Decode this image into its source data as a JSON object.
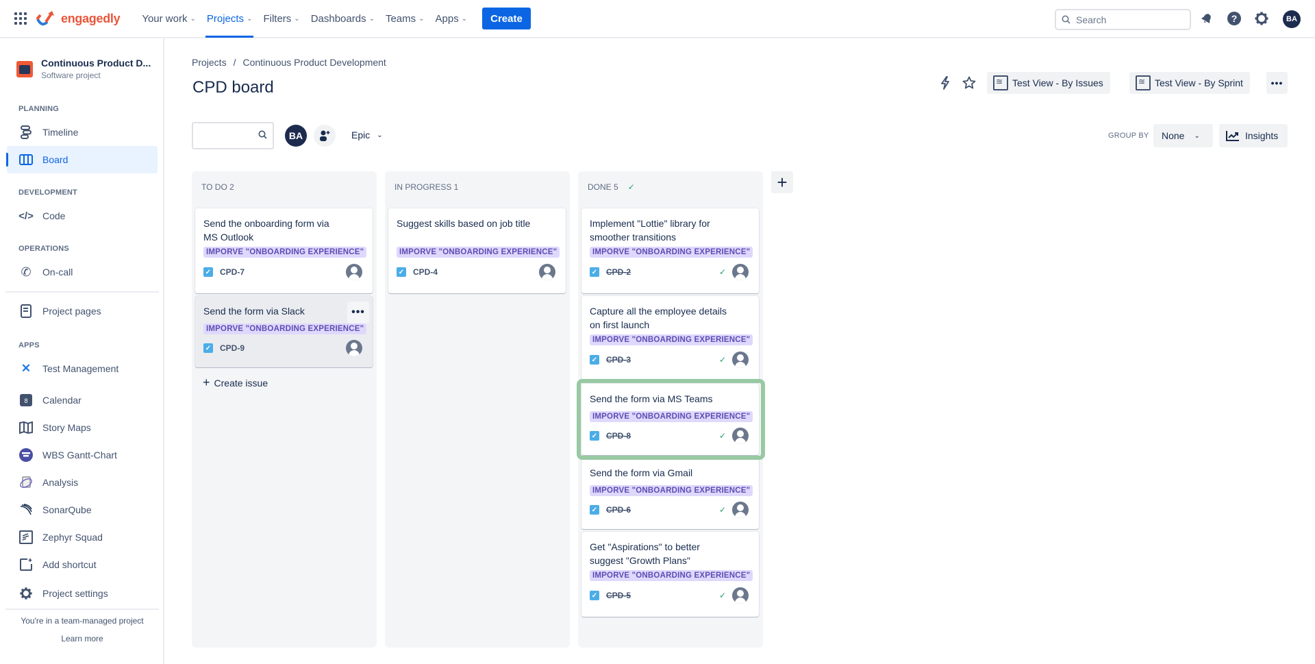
{
  "topnav": {
    "logo_text": "engagedly",
    "items": [
      {
        "label": "Your work",
        "active": false
      },
      {
        "label": "Projects",
        "active": true
      },
      {
        "label": "Filters",
        "active": false
      },
      {
        "label": "Dashboards",
        "active": false
      },
      {
        "label": "Teams",
        "active": false
      },
      {
        "label": "Apps",
        "active": false
      }
    ],
    "create_label": "Create",
    "search_placeholder": "Search",
    "avatar_initials": "BA"
  },
  "sidebar": {
    "project_name": "Continuous Product D...",
    "project_type": "Software project",
    "sections": {
      "planning": "PLANNING",
      "development": "DEVELOPMENT",
      "operations": "OPERATIONS",
      "apps": "APPS"
    },
    "items": [
      {
        "label": "Timeline",
        "icon": "timeline-icon"
      },
      {
        "label": "Board",
        "icon": "board-icon",
        "active": true
      },
      {
        "label": "Code",
        "icon": "code-icon"
      },
      {
        "label": "On-call",
        "icon": "on-call-icon"
      },
      {
        "label": "Project pages",
        "icon": "page-icon"
      },
      {
        "label": "Test Management",
        "icon": "test-management-icon"
      },
      {
        "label": "Calendar",
        "icon": "calendar-icon"
      },
      {
        "label": "Story Maps",
        "icon": "map-icon"
      },
      {
        "label": "WBS Gantt-Chart",
        "icon": "gantt-icon"
      },
      {
        "label": "Analysis",
        "icon": "analysis-icon"
      },
      {
        "label": "SonarQube",
        "icon": "sonarqube-icon"
      },
      {
        "label": "Zephyr Squad",
        "icon": "zephyr-icon"
      },
      {
        "label": "Add shortcut",
        "icon": "add-shortcut-icon"
      },
      {
        "label": "Project settings",
        "icon": "gear-icon"
      }
    ],
    "footer_text": "You're in a team-managed project",
    "footer_link": "Learn more"
  },
  "main": {
    "breadcrumb": [
      "Projects",
      "Continuous Product Development"
    ],
    "title": "CPD board",
    "header_buttons": [
      "Test View - By Issues",
      "Test View - By Sprint"
    ],
    "filter_avatar": "BA",
    "epic_filter": "Epic",
    "group_by_label": "GROUP BY",
    "group_by_value": "None",
    "insights_label": "Insights",
    "create_issue_label": "Create issue",
    "columns": [
      {
        "title": "TO DO 2",
        "cards": [
          {
            "title": "Send the onboarding form via MS Outlook",
            "epic": "IMPORVE \"ONBOARDING EXPERIENCE\"",
            "key": "CPD-7",
            "done": false
          },
          {
            "title": "Send the form via Slack",
            "epic": "IMPORVE \"ONBOARDING EXPERIENCE\"",
            "key": "CPD-9",
            "done": false
          }
        ]
      },
      {
        "title": "IN PROGRESS 1",
        "cards": [
          {
            "title": "Suggest skills based on job title",
            "epic": "IMPORVE \"ONBOARDING EXPERIENCE\"",
            "key": "CPD-4",
            "done": false
          }
        ]
      },
      {
        "title": "DONE 5",
        "cards": [
          {
            "title": "Implement \"Lottie\" library for smoother transitions",
            "epic": "IMPORVE \"ONBOARDING EXPERIENCE\"",
            "key": "CPD-2",
            "done": true
          },
          {
            "title": "Capture all the employee details on first launch",
            "epic": "IMPORVE \"ONBOARDING EXPERIENCE\"",
            "key": "CPD-3",
            "done": true
          },
          {
            "title": "Send the form via MS Teams",
            "epic": "IMPORVE \"ONBOARDING EXPERIENCE\"",
            "key": "CPD-8",
            "done": true
          },
          {
            "title": "Send the form via Gmail",
            "epic": "IMPORVE \"ONBOARDING EXPERIENCE\"",
            "key": "CPD-6",
            "done": true
          },
          {
            "title": "Get \"Aspirations\" to better suggest \"Growth Plans\"",
            "epic": "IMPORVE \"ONBOARDING EXPERIENCE\"",
            "key": "CPD-5",
            "done": true
          }
        ]
      }
    ]
  }
}
